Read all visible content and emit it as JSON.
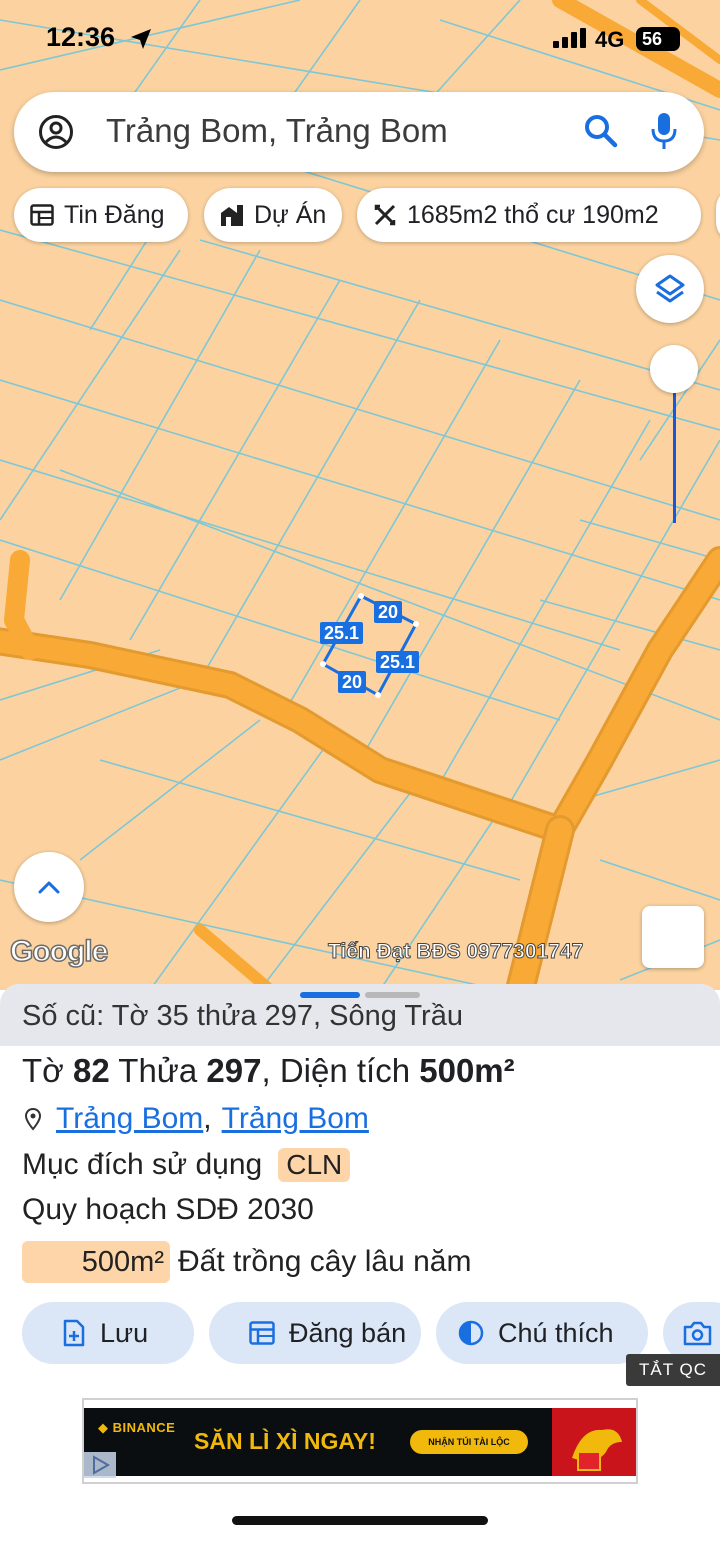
{
  "status_bar": {
    "time": "12:36",
    "network": "4G",
    "battery": "56"
  },
  "search": {
    "query": "Trảng Bom, Trảng Bom"
  },
  "chips": [
    {
      "label": "Tin Đăng",
      "icon": "listing-icon"
    },
    {
      "label": "Dự Án",
      "icon": "building-icon"
    },
    {
      "label": "1685m2 thổ cư 190m2",
      "icon": "measure-icon"
    }
  ],
  "map": {
    "attribution": "Google",
    "watermark": "Tiến Đạt BĐS 0977301747",
    "dimensions": [
      "20",
      "25.1",
      "25.1",
      "20"
    ],
    "colors": {
      "land": "#fcd3a0",
      "road": "#f9a935",
      "parcel_lines": "#7ec7d6",
      "selection": "#1a6fe0"
    }
  },
  "sheet": {
    "old_info": "Số cũ: Tờ 35 thửa 297, Sông Trầu",
    "parcel": {
      "sheet_label": "Tờ",
      "sheet_no": "82",
      "plot_label": "Thửa",
      "plot_no": "297",
      "area_label": "Diện tích",
      "area_value": "500m²"
    },
    "location": {
      "district": "Trảng Bom",
      "separator": ",",
      "commune": "Trảng Bom"
    },
    "purpose": {
      "label": "Mục đích sử dụng",
      "code": "CLN"
    },
    "plan": "Quy hoạch SDĐ 2030",
    "zoning": {
      "area": "500m²",
      "type": "Đất trồng cây lâu năm"
    },
    "actions": [
      {
        "label": "Lưu",
        "icon": "add-file-icon"
      },
      {
        "label": "Đăng bán",
        "icon": "listing-icon"
      },
      {
        "label": "Chú thích",
        "icon": "contrast-icon"
      }
    ]
  },
  "ad": {
    "close_label": "TẮT QC",
    "brand": "BINANCE",
    "headline": "SĂN LÌ XÌ NGAY!",
    "cta": "NHẬN TÚI TÀI LỘC"
  }
}
